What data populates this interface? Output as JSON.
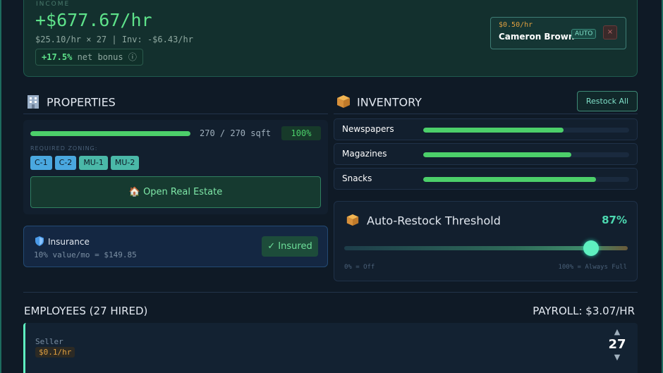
{
  "income": {
    "label": "INCOME",
    "value": "+$677.67/hr",
    "breakdown": "$25.10/hr × 27 | Inv: -$6.43/hr",
    "bonus_value": "+17.5%",
    "bonus_text": " net bonus ⓘ"
  },
  "manager": {
    "rate": "$0.50/hr",
    "name": "Cameron Brown",
    "badge": "AUTO",
    "close": "×"
  },
  "properties": {
    "title": "PROPERTIES",
    "sqft_text": "270 / 270 sqft",
    "sqft_fraction": 1.0,
    "percent": "100%",
    "zoning_label": "REQUIRED ZONING:",
    "zones": [
      "C-1",
      "C-2",
      "MU-1",
      "MU-2"
    ],
    "open_button": "🏠 Open Real Estate"
  },
  "insurance": {
    "title": "Insurance",
    "subtitle": "10% value/mo = $149.85",
    "status_button": "✓ Insured"
  },
  "inventory": {
    "title": "INVENTORY",
    "restock_button": "Restock All",
    "items": [
      {
        "name": "Newspapers",
        "level": 0.68
      },
      {
        "name": "Magazines",
        "level": 0.72
      },
      {
        "name": "Snacks",
        "level": 0.84
      }
    ]
  },
  "threshold": {
    "title": "Auto-Restock Threshold",
    "percent_label": "87%",
    "value": 0.87,
    "min_label": "0% = Off",
    "max_label": "100% = Always Full"
  },
  "employees": {
    "title": "EMPLOYEES (27 HIRED)",
    "payroll": "PAYROLL: $3.07/HR",
    "rows": [
      {
        "role": "Seller",
        "rate": "$0.1/hr",
        "count": "27"
      }
    ]
  },
  "colors": {
    "accent": "#5ee28a",
    "teal": "#5ef0c0",
    "warning": "#e0a040"
  }
}
